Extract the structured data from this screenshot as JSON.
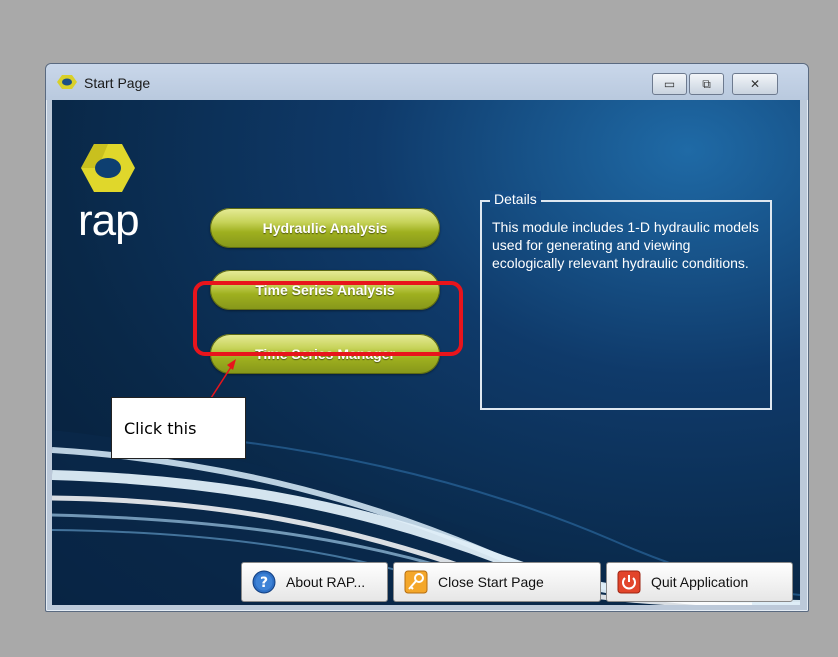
{
  "window": {
    "title": "Start Page"
  },
  "logo": {
    "text": "rap"
  },
  "modules": [
    {
      "label": "Hydraulic Analysis"
    },
    {
      "label": "Time Series Analysis"
    },
    {
      "label": "Time Series Manager"
    }
  ],
  "details": {
    "legend": "Details",
    "text": "This module includes 1-D hydraulic models used for generating and viewing ecologically relevant hydraulic conditions."
  },
  "footer": {
    "about_label": "About RAP...",
    "close_label": "Close Start Page",
    "quit_label": "Quit Application"
  },
  "annotation": {
    "callout_text": "Click this"
  },
  "colors": {
    "module_button": "#c7d35a",
    "highlight": "#e8141c",
    "background": "#092848"
  }
}
